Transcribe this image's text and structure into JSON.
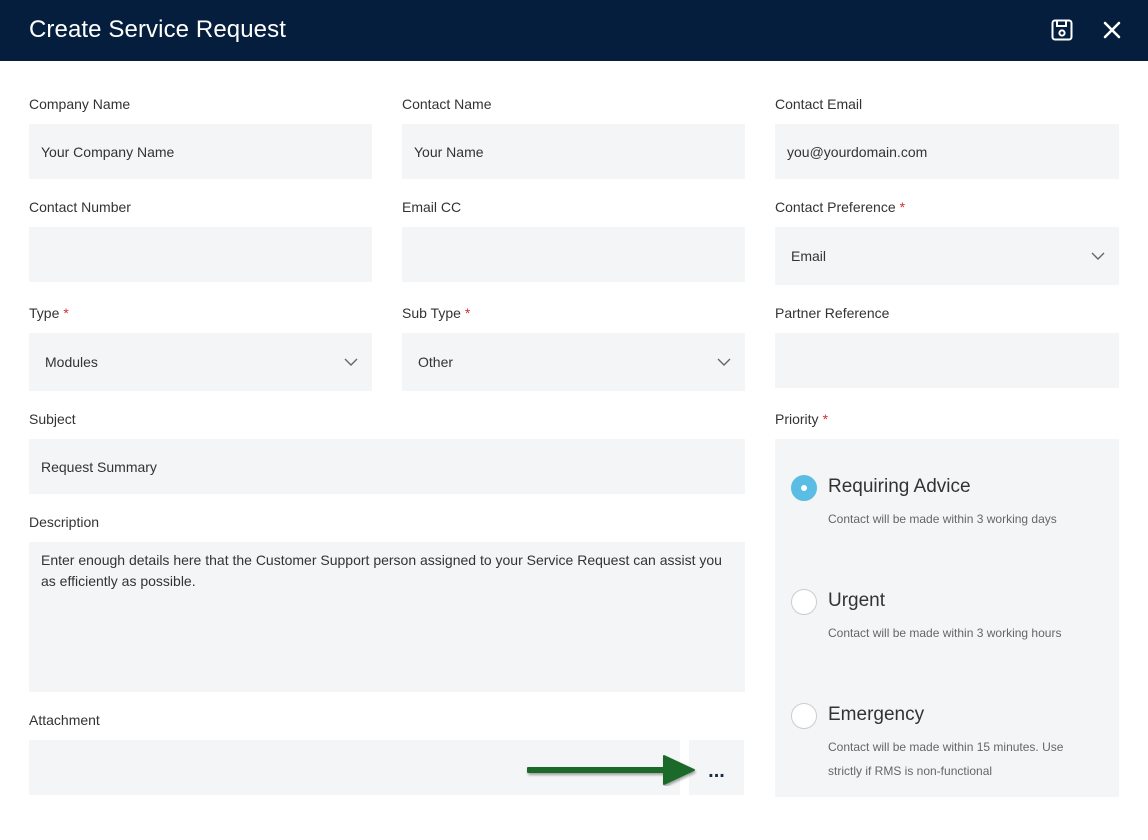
{
  "header": {
    "title": "Create Service Request",
    "save_icon": "save-icon",
    "close_icon": "close-icon"
  },
  "form": {
    "company_name": {
      "label": "Company Name",
      "placeholder": "Your Company Name"
    },
    "contact_name": {
      "label": "Contact Name",
      "placeholder": "Your Name"
    },
    "contact_email": {
      "label": "Contact Email",
      "placeholder": "you@yourdomain.com"
    },
    "contact_number": {
      "label": "Contact Number",
      "placeholder": ""
    },
    "email_cc": {
      "label": "Email CC",
      "placeholder": ""
    },
    "contact_preference": {
      "label": "Contact Preference",
      "required": "*",
      "value": "Email"
    },
    "type": {
      "label": "Type",
      "required": "*",
      "value": "Modules"
    },
    "sub_type": {
      "label": "Sub Type",
      "required": "*",
      "value": "Other"
    },
    "partner_reference": {
      "label": "Partner Reference",
      "placeholder": ""
    },
    "subject": {
      "label": "Subject",
      "placeholder": "Request Summary"
    },
    "description": {
      "label": "Description",
      "placeholder": "Enter enough details here that the Customer Support person assigned to your Service Request can assist you as efficiently as possible."
    },
    "attachment": {
      "label": "Attachment",
      "browse_label": "..."
    },
    "priority": {
      "label": "Priority",
      "required": "*",
      "options": [
        {
          "title": "Requiring Advice",
          "desc": "Contact will be made within 3 working days",
          "checked": true
        },
        {
          "title": "Urgent",
          "desc": "Contact will be made within 3 working hours",
          "checked": false
        },
        {
          "title": "Emergency",
          "desc": "Contact will be made within 15 minutes. Use strictly if RMS is non-functional",
          "checked": false
        }
      ]
    }
  },
  "colors": {
    "header_bg": "#061e3d",
    "field_bg": "#f4f5f7",
    "required": "#d0312d",
    "radio_checked": "#5bbde3",
    "arrow": "#1e6b2a"
  }
}
